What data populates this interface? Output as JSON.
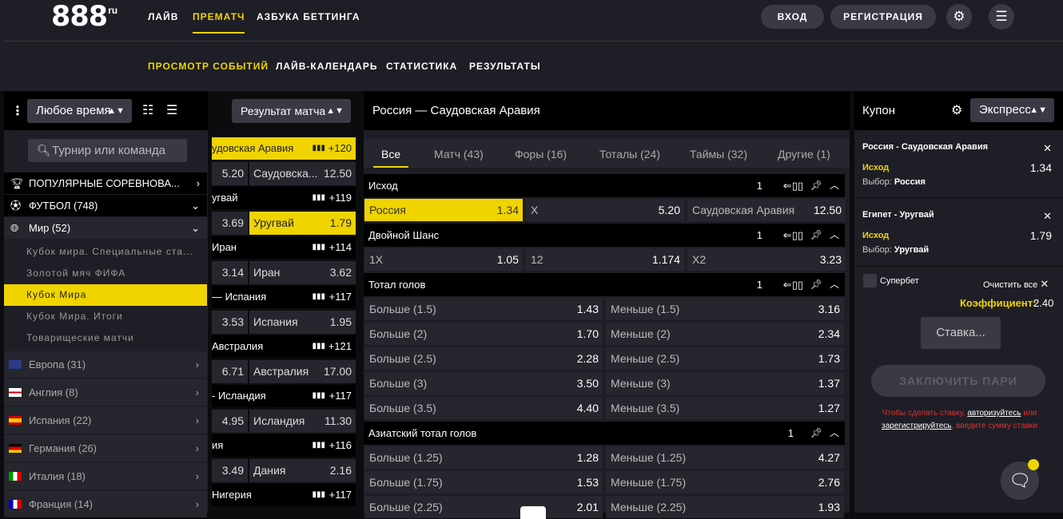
{
  "header": {
    "logo_text": "888",
    "logo_suffix": "ru",
    "nav": [
      "ЛАЙВ",
      "ПРЕМАТЧ",
      "АЗБУКА БЕТТИНГА"
    ],
    "subnav": [
      "ПРОСМОТР СОБЫТИЙ",
      "ЛАЙВ-КАЛЕНДАРЬ",
      "СТАТИСТИКА",
      "РЕЗУЛЬТАТЫ"
    ],
    "login": "ВХОД",
    "register": "РЕГИСТРАЦИЯ",
    "accent": "#f0d400"
  },
  "left": {
    "time_filter": "Любое время",
    "search_placeholder": "Турнир или команда",
    "popular": "ПОПУЛЯРНЫЕ СОРЕВНОВА...",
    "football": "ФУТБОЛ (748)",
    "world": "Мир (52)",
    "sub_items": [
      "Кубок мира. Специальные ста...",
      "Золотой мяч ФИФА",
      "Кубок Мира",
      "Кубок Мира. Итоги",
      "Товарищеские матчи"
    ],
    "countries": [
      "Европа (31)",
      "Англия (8)",
      "Испания (22)",
      "Германия (26)",
      "Италия (18)",
      "Франция (14)"
    ]
  },
  "events": {
    "market_filter": "Результат матча",
    "items": [
      {
        "title": "удовская Аравия",
        "count": "+120",
        "o1": "5.20",
        "o2_label": "Саудовска...",
        "o2": "12.50"
      },
      {
        "title": "угвай",
        "count": "+119",
        "o1": "3.69",
        "o2_label": "Уругвай",
        "o2": "1.79"
      },
      {
        "title": "Иран",
        "count": "+114",
        "o1": "3.14",
        "o2_label": "Иран",
        "o2": "3.62"
      },
      {
        "title": "— Испания",
        "count": "+117",
        "o1": "3.53",
        "o2_label": "Испания",
        "o2": "1.95"
      },
      {
        "title": "Австралия",
        "count": "+121",
        "o1": "6.71",
        "o2_label": "Австралия",
        "o2": "17.00"
      },
      {
        "title": "- Исландия",
        "count": "+117",
        "o1": "4.95",
        "o2_label": "Исландия",
        "o2": "11.30"
      },
      {
        "title": "ия",
        "count": "+116",
        "o1": "3.49",
        "o2_label": "Дания",
        "o2": "2.16"
      },
      {
        "title": "Нигерия",
        "count": "+117",
        "o1": "",
        "o2_label": "",
        "o2": ""
      }
    ]
  },
  "main": {
    "title": "Россия — Саудовская Аравия",
    "tabs": [
      "Все",
      "Матч (43)",
      "Форы (16)",
      "Тоталы (24)",
      "Таймы (32)",
      "Другие (1)"
    ],
    "markets": [
      {
        "name": "Исход",
        "n": "1",
        "rows": [
          [
            [
              "Россия",
              "1.34"
            ],
            [
              "X",
              "5.20"
            ],
            [
              "Саудовская Аравия",
              "12.50"
            ]
          ]
        ]
      },
      {
        "name": "Двойной Шанс",
        "n": "1",
        "rows": [
          [
            [
              "1X",
              "1.05"
            ],
            [
              "12",
              "1.174"
            ],
            [
              "X2",
              "3.23"
            ]
          ]
        ]
      },
      {
        "name": "Тотал голов",
        "n": "1",
        "rows": [
          [
            [
              "Больше (1.5)",
              "1.43"
            ],
            [
              "Меньше (1.5)",
              "3.16"
            ]
          ],
          [
            [
              "Больше (2)",
              "1.70"
            ],
            [
              "Меньше (2)",
              "2.34"
            ]
          ],
          [
            [
              "Больше (2.5)",
              "2.28"
            ],
            [
              "Меньше (2.5)",
              "1.73"
            ]
          ],
          [
            [
              "Больше (3)",
              "3.50"
            ],
            [
              "Меньше (3)",
              "1.37"
            ]
          ],
          [
            [
              "Больше (3.5)",
              "4.40"
            ],
            [
              "Меньше (3.5)",
              "1.27"
            ]
          ]
        ]
      },
      {
        "name": "Азиатский тотал голов",
        "n": "1",
        "rows": [
          [
            [
              "Больше (1.25)",
              "1.28"
            ],
            [
              "Меньше (1.25)",
              "4.27"
            ]
          ],
          [
            [
              "Больше (1.75)",
              "1.53"
            ],
            [
              "Меньше (1.75)",
              "2.76"
            ]
          ],
          [
            [
              "Больше (2.25)",
              "2.01"
            ],
            [
              "Меньше (2.25)",
              "1.93"
            ]
          ]
        ]
      }
    ]
  },
  "coupon": {
    "title": "Купон",
    "mode": "Экспресс",
    "bets": [
      {
        "event": "Россия - Саудовская Аравия",
        "market": "Исход",
        "odd": "1.34",
        "choice_label": "Выбор:",
        "choice": "Россия"
      },
      {
        "event": "Египет - Уругвай",
        "market": "Исход",
        "odd": "1.79",
        "choice_label": "Выбор:",
        "choice": "Уругвай"
      }
    ],
    "superbet": "Супербет",
    "clear_all": "Очистить все",
    "coef_label": "Коэффициент:",
    "coef_value": "2.40",
    "stake_placeholder": "Ставка...",
    "place_bet": "ЗАКЛЮЧИТЬ ПАРИ",
    "notice_1": "Чтобы сделать ставку,",
    "notice_login": "авторизуйтесь",
    "notice_or": "или",
    "notice_register": "зарегистрируйтесь",
    "notice_2": ", введите сумму ставки"
  }
}
